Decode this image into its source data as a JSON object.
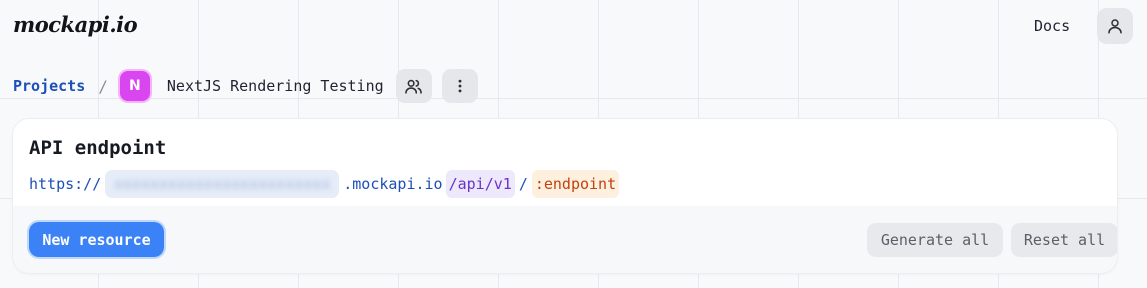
{
  "header": {
    "logo": "mockapi.io",
    "docs_label": "Docs",
    "user_icon": "user-icon"
  },
  "breadcrumb": {
    "projects_label": "Projects",
    "separator": "/",
    "project_initial": "N",
    "project_color": "#d946ef",
    "project_name": "NextJS Rendering Testing",
    "members_icon": "users-icon",
    "more_icon": "more-vertical-icon"
  },
  "endpoint_card": {
    "title": "API endpoint",
    "url_scheme": "https://",
    "url_host_redacted": "xxxxxxxxxxxxxxxxxxxxxxxx",
    "url_domain": ".mockapi.io",
    "url_path": "/api/v1",
    "url_slash": "/",
    "url_endpoint": ":endpoint"
  },
  "actions": {
    "new_resource_label": "New resource",
    "generate_all_label": "Generate all",
    "reset_all_label": "Reset all"
  },
  "colors": {
    "accent": "#3b82f6",
    "link": "#1d4fb8",
    "path": "#6a34c9",
    "endpoint": "#c2410c"
  }
}
